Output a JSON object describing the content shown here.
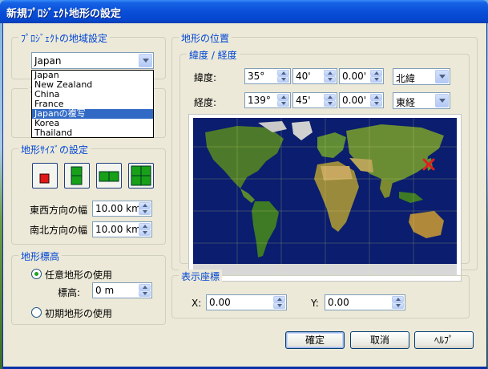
{
  "window": {
    "title": "新規ﾌﾟﾛｼﾞｪｸﾄ地形の設定"
  },
  "region": {
    "group_title": "ﾌﾟﾛｼﾞｪｸﾄの地域設定",
    "selected": "Japan",
    "options": [
      "Japan",
      "New Zealand",
      "China",
      "France",
      "Japanの複写",
      "Korea",
      "Thailand"
    ],
    "highlighted_index": 4
  },
  "hidden_group_title_char": "地",
  "size": {
    "group_title": "地形ｻｲｽﾞの設定",
    "ew_label": "東西方向の幅",
    "ew_value": "10.00 km",
    "ns_label": "南北方向の幅",
    "ns_value": "10.00 km"
  },
  "elevation": {
    "group_title": "地形標高",
    "option_arbitrary": "任意地形の使用",
    "height_label": "標高:",
    "height_value": "0 m",
    "option_initial": "初期地形の使用"
  },
  "position": {
    "group_title": "地形の位置",
    "sub_title": "緯度 / 経度",
    "lat_label": "緯度:",
    "lat_deg": "35°",
    "lat_min": "40'",
    "lat_sec": "0.00'",
    "lat_dir": "北緯",
    "lon_label": "経度:",
    "lon_deg": "139°",
    "lon_min": "45'",
    "lon_sec": "0.00'",
    "lon_dir": "東経"
  },
  "coords": {
    "group_title": "表示座標",
    "x_label": "X:",
    "x_value": "0.00",
    "y_label": "Y:",
    "y_value": "0.00"
  },
  "buttons": {
    "ok": "確定",
    "cancel": "取消",
    "help": "ﾍﾙﾌﾟ"
  },
  "colors": {
    "accent": "#0046d5",
    "selection": "#316ac5",
    "marker": "#e02020"
  }
}
